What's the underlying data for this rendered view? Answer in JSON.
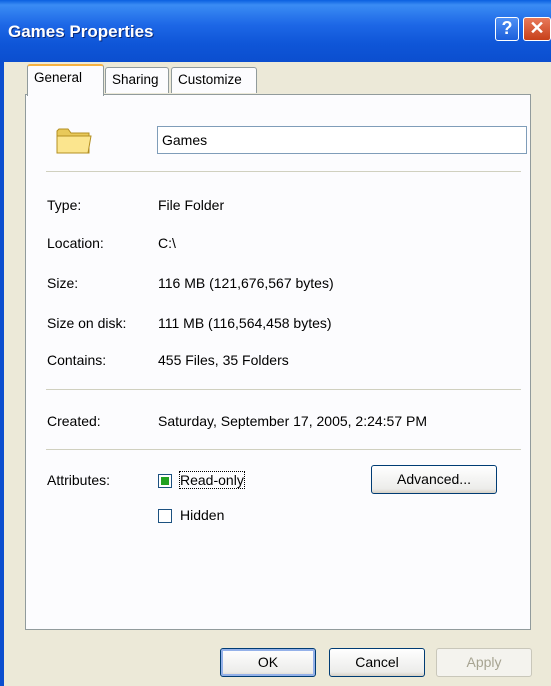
{
  "window": {
    "title": "Games Properties",
    "help_glyph": "?",
    "close_glyph": "✕"
  },
  "tabs": [
    {
      "label": "General",
      "active": true
    },
    {
      "label": "Sharing",
      "active": false
    },
    {
      "label": "Customize",
      "active": false
    }
  ],
  "general": {
    "icon": "folder-icon",
    "name_value": "Games",
    "rows": [
      {
        "label": "Type:",
        "value": "File Folder"
      },
      {
        "label": "Location:",
        "value": "C:\\"
      },
      {
        "label": "Size:",
        "value": "116 MB (121,676,567 bytes)"
      },
      {
        "label": "Size on disk:",
        "value": "111 MB (116,564,458 bytes)"
      },
      {
        "label": "Contains:",
        "value": "455 Files, 35 Folders"
      }
    ],
    "created": {
      "label": "Created:",
      "value": "Saturday, September 17, 2005, 2:24:57 PM"
    },
    "attributes": {
      "label": "Attributes:",
      "readonly_label": "Read-only",
      "readonly_state": "mixed",
      "hidden_label": "Hidden",
      "hidden_state": "unchecked",
      "advanced_label": "Advanced..."
    }
  },
  "buttons": {
    "ok": "OK",
    "cancel": "Cancel",
    "apply": "Apply"
  },
  "colors": {
    "titlebar": "#0b4ecf",
    "face": "#ece9d8",
    "panel": "#fcfcfe",
    "tab_highlight": "#f6b242",
    "mixed_check": "#21a121"
  }
}
